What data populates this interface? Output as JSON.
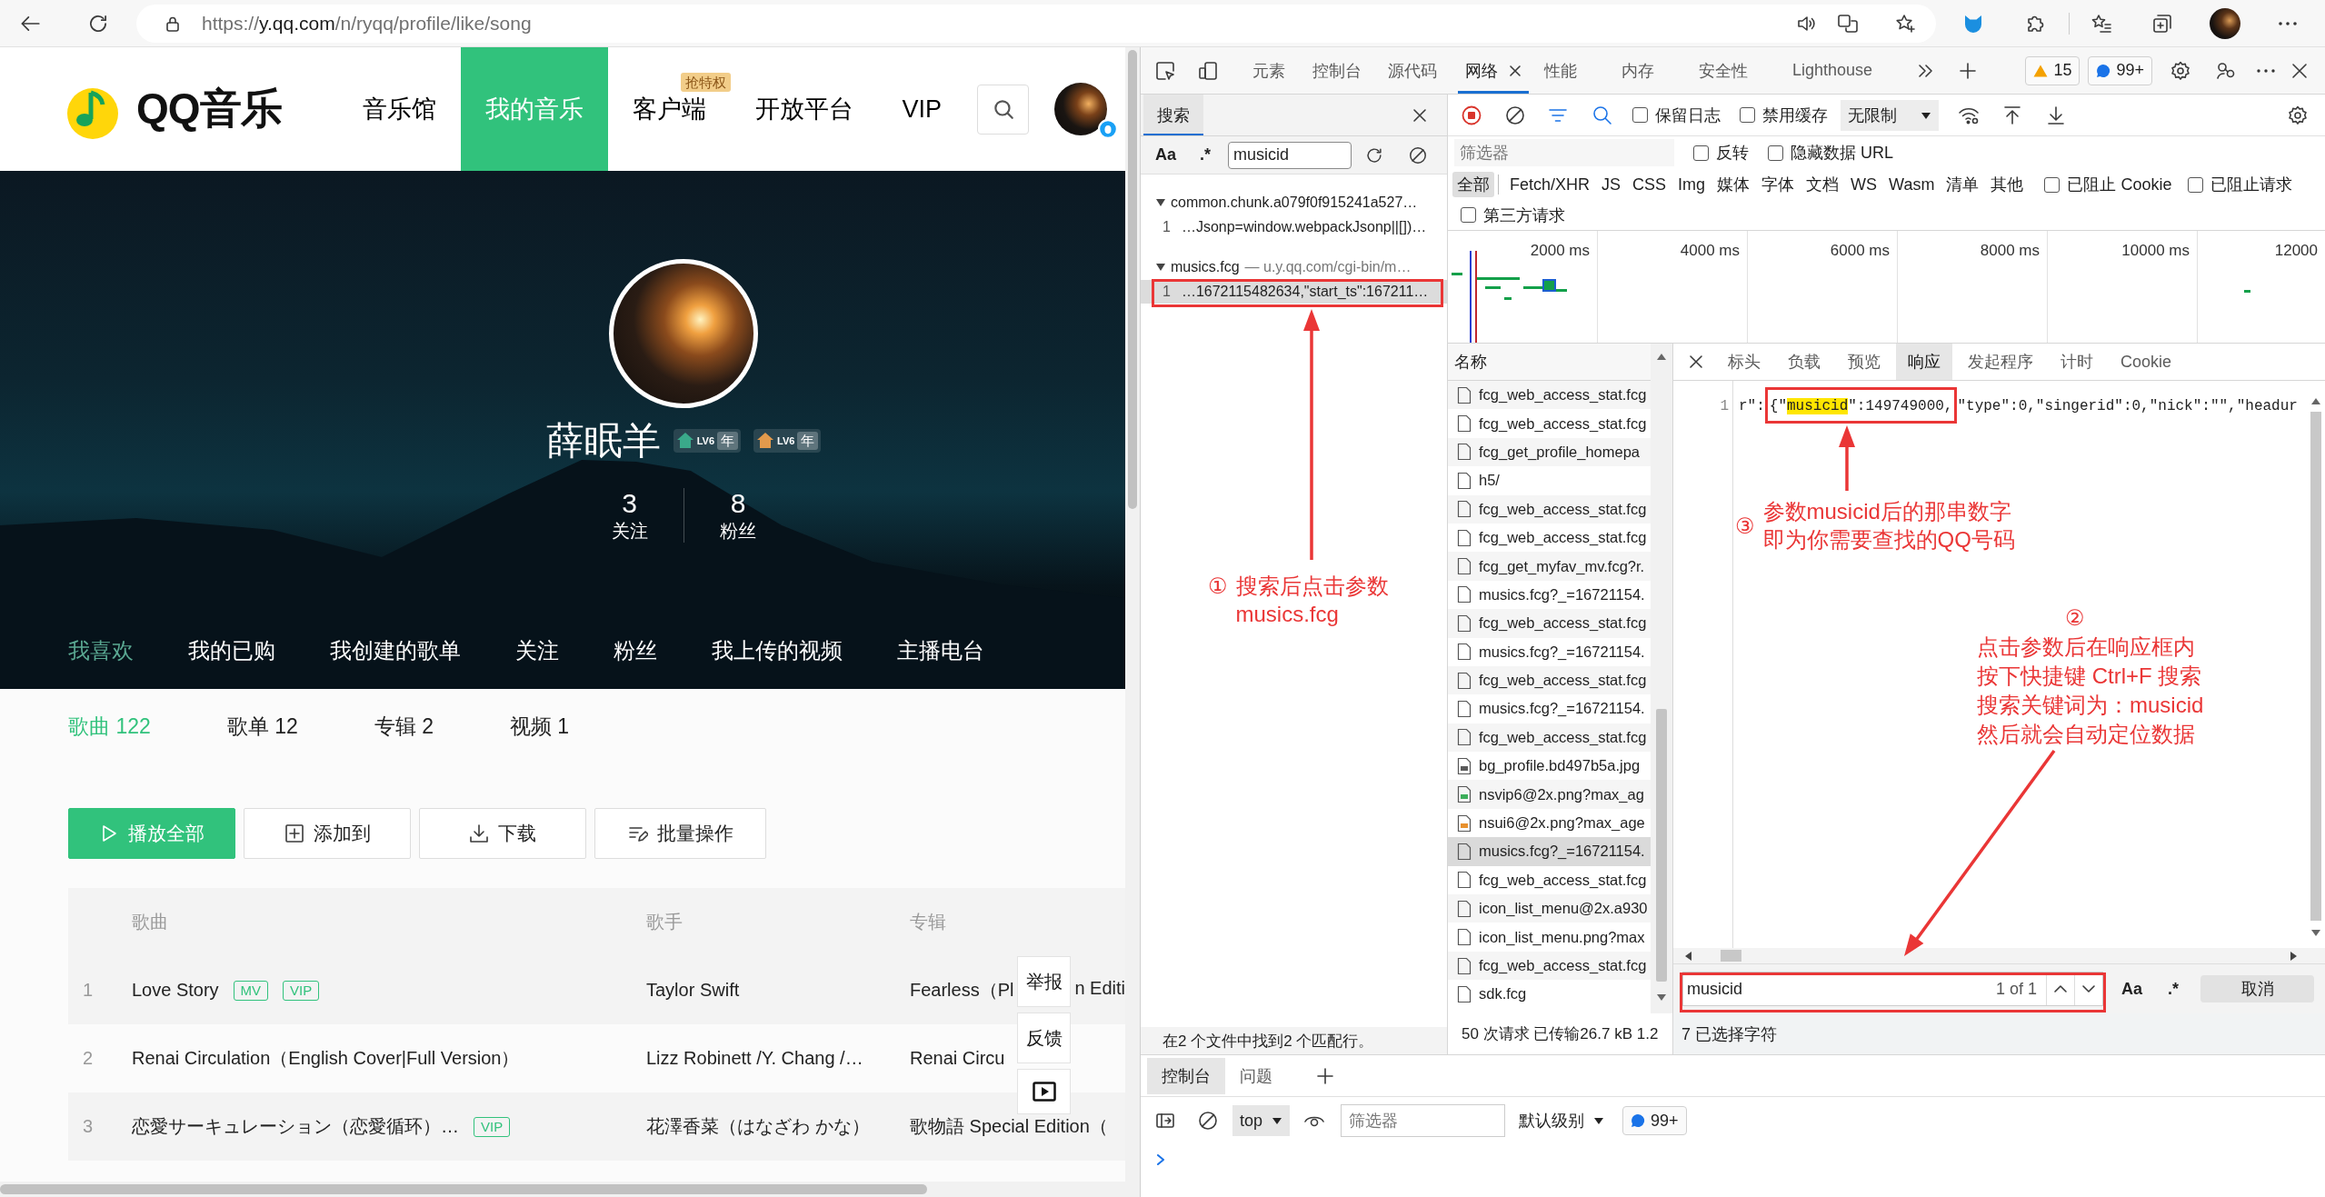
{
  "browser": {
    "url": {
      "scheme": "https://",
      "host": "y.qq.com",
      "path": "/n/ryqq/profile/like/song"
    }
  },
  "site": {
    "logo": "QQ音乐",
    "nav": [
      {
        "label": "音乐馆",
        "selected": false
      },
      {
        "label": "我的音乐",
        "selected": true
      },
      {
        "label": "客户端",
        "selected": false,
        "badge": "抢特权"
      },
      {
        "label": "开放平台",
        "selected": false
      },
      {
        "label": "VIP",
        "selected": false
      }
    ]
  },
  "profile": {
    "name": "薛眠羊",
    "badges": [
      {
        "label": "LV6",
        "suffix": "年",
        "color": "#3aa98a"
      },
      {
        "label": "LV6",
        "suffix": "年",
        "color": "#e39a4c"
      }
    ],
    "stats": [
      {
        "value": "3",
        "label": "关注"
      },
      {
        "value": "8",
        "label": "粉丝"
      }
    ],
    "tabs": [
      {
        "label": "我喜欢",
        "selected": true
      },
      {
        "label": "我的已购",
        "selected": false
      },
      {
        "label": "我创建的歌单",
        "selected": false
      },
      {
        "label": "关注",
        "selected": false
      },
      {
        "label": "粉丝",
        "selected": false
      },
      {
        "label": "我上传的视频",
        "selected": false
      },
      {
        "label": "主播电台",
        "selected": false
      }
    ]
  },
  "library": {
    "tabs": [
      {
        "label": "歌曲 122",
        "selected": true
      },
      {
        "label": "歌单 12",
        "selected": false
      },
      {
        "label": "专辑 2",
        "selected": false
      },
      {
        "label": "视频 1",
        "selected": false
      }
    ],
    "actions": [
      {
        "label": "播放全部",
        "kind": "play"
      },
      {
        "label": "添加到",
        "kind": "add"
      },
      {
        "label": "下载",
        "kind": "download"
      },
      {
        "label": "批量操作",
        "kind": "batch"
      }
    ]
  },
  "table": {
    "columns": [
      "歌曲",
      "歌手",
      "专辑"
    ],
    "rows": [
      {
        "index": "1",
        "title": "Love Story",
        "tags": [
          "MV",
          "VIP"
        ],
        "singer": "Taylor Swift",
        "album": "Fearless（Pl",
        "album_tail": "n Editi"
      },
      {
        "index": "2",
        "title": "Renai Circulation（English Cover|Full Version）",
        "singer": "Lizz Robinett /Y. Chang /…",
        "album": "Renai Circu"
      },
      {
        "index": "3",
        "title": "恋愛サーキュレーション（恋愛循环）…",
        "tags": [
          "VIP"
        ],
        "singer": "花澤香菜（はなざわ かな）",
        "album": "歌物語 Special Edition（"
      }
    ]
  },
  "side_buttons": [
    {
      "kind": "text",
      "label": "举报"
    },
    {
      "kind": "text",
      "label": "反馈"
    },
    {
      "kind": "video"
    }
  ],
  "devtools": {
    "tabs": [
      {
        "label": "元素",
        "selected": false
      },
      {
        "label": "控制台",
        "selected": false
      },
      {
        "label": "源代码",
        "selected": false
      },
      {
        "label": "网络",
        "selected": true
      },
      {
        "label": "性能",
        "selected": false
      },
      {
        "label": "内存",
        "selected": false
      },
      {
        "label": "安全性",
        "selected": false
      },
      {
        "label": "Lighthouse",
        "selected": false
      }
    ],
    "warnings": "15",
    "messages": "99+",
    "search": {
      "title": "搜索",
      "case_toggle": "Aa",
      "regex_toggle": ".*",
      "query": "musicid",
      "results": [
        {
          "file": "common.chunk.a079f0f915241a527…",
          "expanded": true,
          "matches": [
            {
              "line": "1",
              "text": "…Jsonp=window.webpackJsonp||[])…",
              "selected": false
            }
          ]
        },
        {
          "file": "musics.fcg",
          "source": "— u.y.qq.com/cgi-bin/m…",
          "expanded": true,
          "matches": [
            {
              "line": "1",
              "text": "…1672115482634,\"start_ts\":167211…",
              "selected": true
            }
          ]
        }
      ],
      "status": "在2 个文件中找到2 个匹配行。"
    },
    "network": {
      "recording": true,
      "options": [
        {
          "label": "保留日志",
          "checked": false
        },
        {
          "label": "禁用缓存",
          "checked": false
        }
      ],
      "throttle": "无限制",
      "filter": {
        "placeholder": "筛选器",
        "options": [
          {
            "label": "反转",
            "checked": false
          },
          {
            "label": "隐藏数据 URL",
            "checked": false
          }
        ]
      },
      "types": [
        {
          "label": "全部",
          "selected": true
        },
        {
          "label": "Fetch/XHR",
          "selected": false
        },
        {
          "label": "JS",
          "selected": false
        },
        {
          "label": "CSS",
          "selected": false
        },
        {
          "label": "Img",
          "selected": false
        },
        {
          "label": "媒体",
          "selected": false
        },
        {
          "label": "字体",
          "selected": false
        },
        {
          "label": "文档",
          "selected": false
        },
        {
          "label": "WS",
          "selected": false
        },
        {
          "label": "Wasm",
          "selected": false
        },
        {
          "label": "清单",
          "selected": false
        },
        {
          "label": "其他",
          "selected": false
        }
      ],
      "type_options": [
        {
          "label": "已阻止 Cookie",
          "checked": false
        },
        {
          "label": "已阻止请求",
          "checked": false
        }
      ],
      "third_party": {
        "label": "第三方请求",
        "checked": false
      },
      "ticks": [
        "2000 ms",
        "4000 ms",
        "6000 ms",
        "8000 ms",
        "10000 ms",
        "12000"
      ],
      "name_column": "名称",
      "requests": [
        {
          "name": "fcg_web_access_stat.fcg",
          "kind": "file",
          "selected": false
        },
        {
          "name": "fcg_web_access_stat.fcg",
          "kind": "file",
          "selected": false
        },
        {
          "name": "fcg_get_profile_homepa",
          "kind": "file",
          "selected": false
        },
        {
          "name": "h5/",
          "kind": "file",
          "selected": false
        },
        {
          "name": "fcg_web_access_stat.fcg",
          "kind": "file",
          "selected": false
        },
        {
          "name": "fcg_web_access_stat.fcg",
          "kind": "file",
          "selected": false
        },
        {
          "name": "fcg_get_myfav_mv.fcg?r.",
          "kind": "file",
          "selected": false
        },
        {
          "name": "musics.fcg?_=16721154.",
          "kind": "file",
          "selected": false
        },
        {
          "name": "fcg_web_access_stat.fcg",
          "kind": "file",
          "selected": false
        },
        {
          "name": "musics.fcg?_=16721154.",
          "kind": "file",
          "selected": false
        },
        {
          "name": "fcg_web_access_stat.fcg",
          "kind": "file",
          "selected": false
        },
        {
          "name": "musics.fcg?_=16721154.",
          "kind": "file",
          "selected": false
        },
        {
          "name": "fcg_web_access_stat.fcg",
          "kind": "file",
          "selected": false
        },
        {
          "name": "bg_profile.bd497b5a.jpg",
          "kind": "image",
          "color": "#5a5a5a",
          "selected": false
        },
        {
          "name": "nsvip6@2x.png?max_ag",
          "kind": "image",
          "color": "#3cae5a",
          "selected": false
        },
        {
          "name": "nsui6@2x.png?max_age",
          "kind": "image",
          "color": "#e8912d",
          "selected": false
        },
        {
          "name": "musics.fcg?_=16721154.",
          "kind": "file",
          "selected": true
        },
        {
          "name": "fcg_web_access_stat.fcg",
          "kind": "file",
          "selected": false
        },
        {
          "name": "icon_list_menu@2x.a930",
          "kind": "file",
          "selected": false
        },
        {
          "name": "icon_list_menu.png?max",
          "kind": "file",
          "selected": false
        },
        {
          "name": "fcg_web_access_stat.fcg",
          "kind": "file",
          "selected": false
        },
        {
          "name": "sdk.fcg",
          "kind": "file",
          "selected": false
        }
      ],
      "status": "50 次请求 已传输26.7 kB 1.2",
      "details": {
        "tabs": [
          {
            "label": "标头",
            "selected": false
          },
          {
            "label": "负载",
            "selected": false
          },
          {
            "label": "预览",
            "selected": false
          },
          {
            "label": "响应",
            "selected": true
          },
          {
            "label": "发起程序",
            "selected": false
          },
          {
            "label": "计时",
            "selected": false
          },
          {
            "label": "Cookie",
            "selected": false
          }
        ],
        "line": "1",
        "code": {
          "before": "r\":",
          "open": "{\"",
          "match": "musicid",
          "close": "\":149749000,",
          "after": "\"type\":0,\"singerid\":0,\"nick\":\"\",\"headur"
        },
        "find": {
          "value": "musicid",
          "count": "1 of 1",
          "case_toggle": "Aa",
          "regex_toggle": ".*",
          "cancel": "取消"
        },
        "status": "7 已选择字符"
      }
    },
    "drawer": {
      "tabs": [
        {
          "label": "控制台",
          "selected": true
        },
        {
          "label": "问题",
          "selected": false
        }
      ],
      "context": "top",
      "filter_placeholder": "筛选器",
      "level": "默认级别",
      "messages": "99+"
    }
  },
  "annotations": [
    {
      "marker": "①",
      "lines": [
        "搜索后点击参数",
        "musics.fcg"
      ]
    },
    {
      "marker": "③",
      "lines": [
        "参数musicid后的那串数字",
        "即为你需要查找的QQ号码"
      ]
    },
    {
      "marker": "②",
      "lines": [
        "点击参数后在响应框内",
        "按下快捷键 Ctrl+F 搜索",
        "搜索关键词为：musicid",
        "然后就会自动定位数据"
      ]
    }
  ]
}
